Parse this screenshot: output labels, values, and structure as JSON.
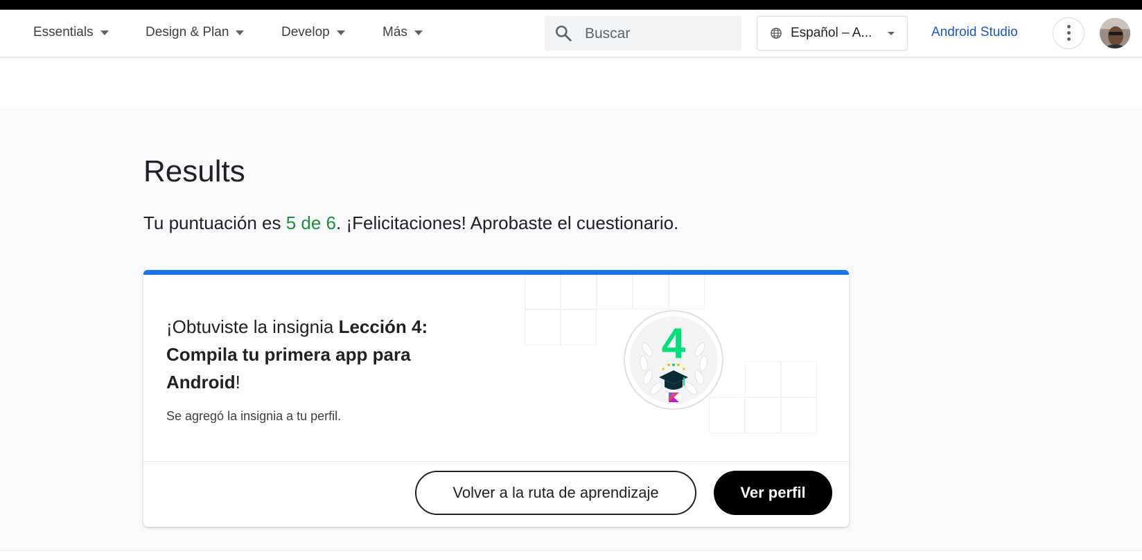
{
  "nav": {
    "items": [
      {
        "label": "Essentials"
      },
      {
        "label": "Design & Plan"
      },
      {
        "label": "Develop"
      },
      {
        "label": "Más"
      }
    ],
    "search_placeholder": "Buscar",
    "language": "Español – A...",
    "studio_link": "Android Studio"
  },
  "results": {
    "title": "Results",
    "score_prefix": "Tu puntuación es ",
    "score_value": "5 de 6",
    "score_suffix": ". ¡Felicitaciones! Aprobaste el cuestionario."
  },
  "badge_card": {
    "earned_prefix": "¡Obtuviste la insignia ",
    "badge_name": "Lección 4: Compila tu primera app para Android",
    "earned_suffix": "!",
    "note": "Se agregó la insignia a tu perfil.",
    "badge_number": "4",
    "back_button": "Volver a la ruta de aprendizaje",
    "profile_button": "Ver perfil"
  },
  "colors": {
    "accent_blue": "#1a73e8",
    "link_blue": "#1a57c7",
    "score_green": "#1e8e3e",
    "badge_green": "#00de7a"
  }
}
